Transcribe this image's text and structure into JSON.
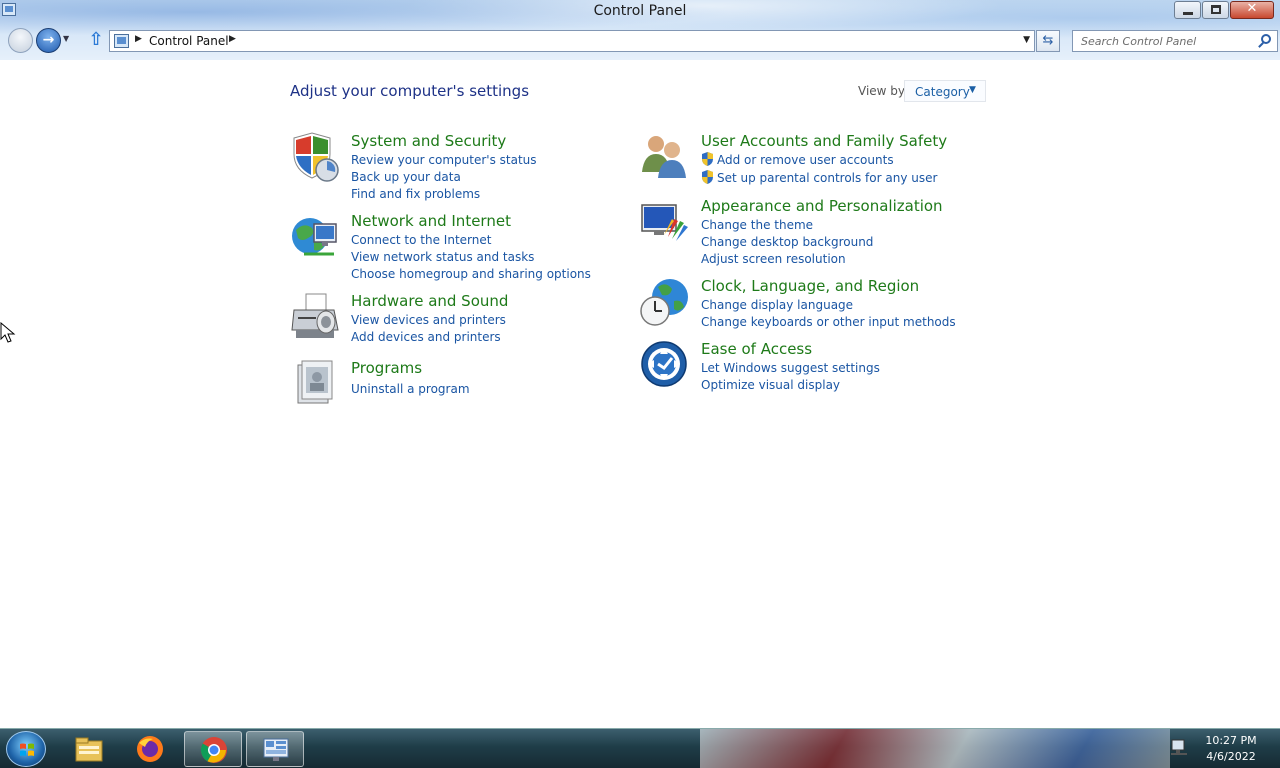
{
  "window": {
    "title": "Control Panel",
    "close_label": "✕"
  },
  "nav": {
    "forward_glyph": "→",
    "up_glyph": "⇧",
    "refresh_glyph": "⇆"
  },
  "address": {
    "location": "Control Panel"
  },
  "search": {
    "placeholder": "Search Control Panel"
  },
  "main": {
    "heading": "Adjust your computer's settings",
    "view_by_label": "View by:",
    "view_by_value": "Category",
    "categories": [
      {
        "title": "System and Security",
        "icon": "security-shield-icon",
        "links": [
          "Review your computer's status",
          "Back up your data",
          "Find and fix problems"
        ]
      },
      {
        "title": "Network and Internet",
        "icon": "network-globe-icon",
        "links": [
          "Connect to the Internet",
          "View network status and tasks",
          "Choose homegroup and sharing options"
        ]
      },
      {
        "title": "Hardware and Sound",
        "icon": "printer-icon",
        "links": [
          "View devices and printers",
          "Add devices and printers"
        ]
      },
      {
        "title": "Programs",
        "icon": "programs-icon",
        "links": [
          "Uninstall a program"
        ]
      },
      {
        "title": "User Accounts and Family Safety",
        "icon": "users-icon",
        "links": [
          "Add or remove user accounts",
          "Set up parental controls for any user"
        ]
      },
      {
        "title": "Appearance and Personalization",
        "icon": "monitor-paint-icon",
        "links": [
          "Change the theme",
          "Change desktop background",
          "Adjust screen resolution"
        ]
      },
      {
        "title": "Clock, Language, and Region",
        "icon": "clock-globe-icon",
        "links": [
          "Change display language",
          "Change keyboards or other input methods"
        ]
      },
      {
        "title": "Ease of Access",
        "icon": "ease-of-access-icon",
        "links": [
          "Let Windows suggest settings",
          "Optimize visual display"
        ]
      }
    ]
  },
  "taskbar": {
    "items": [
      "file-explorer-icon",
      "firefox-icon",
      "chrome-icon",
      "control-panel-icon"
    ],
    "time": "10:27 PM",
    "date": "4/6/2022"
  },
  "colors": {
    "category_title": "#1e7a19",
    "link": "#1a55a3",
    "heading": "#1e3287"
  }
}
